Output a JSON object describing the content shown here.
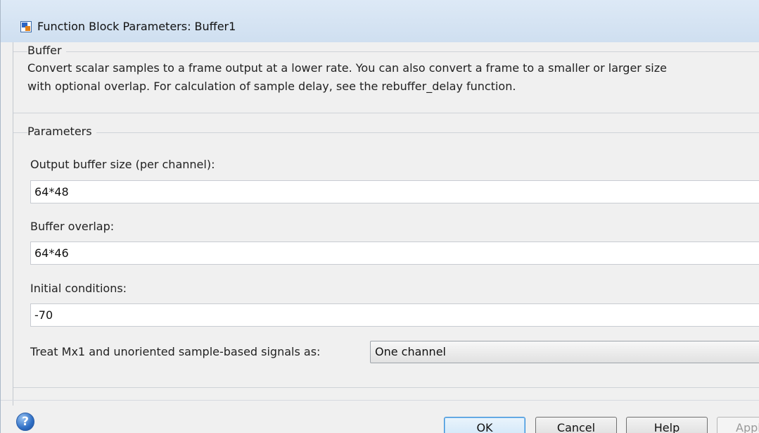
{
  "window": {
    "title": "Function Block Parameters: Buffer1"
  },
  "buffer_group": {
    "title": "Buffer",
    "description_lines": [
      "Convert scalar samples to a frame output at a lower rate. You can also convert a frame to a smaller or larger size",
      "with optional overlap. For calculation of sample delay, see the rebuffer_delay function."
    ]
  },
  "parameters_group": {
    "title": "Parameters",
    "output_buffer_size": {
      "label": "Output buffer size (per channel):",
      "value": "64*48"
    },
    "buffer_overlap": {
      "label": "Buffer overlap:",
      "value": "64*46"
    },
    "initial_conditions": {
      "label": "Initial conditions:",
      "value": "-70"
    },
    "treat_signals": {
      "label": "Treat Mx1 and unoriented sample-based signals as:",
      "selected": "One channel"
    }
  },
  "buttons": {
    "ok": "OK",
    "cancel": "Cancel",
    "help": "Help",
    "apply": "Apply"
  },
  "icons": {
    "title": "simulink-block-icon",
    "help": "help-question-icon"
  }
}
